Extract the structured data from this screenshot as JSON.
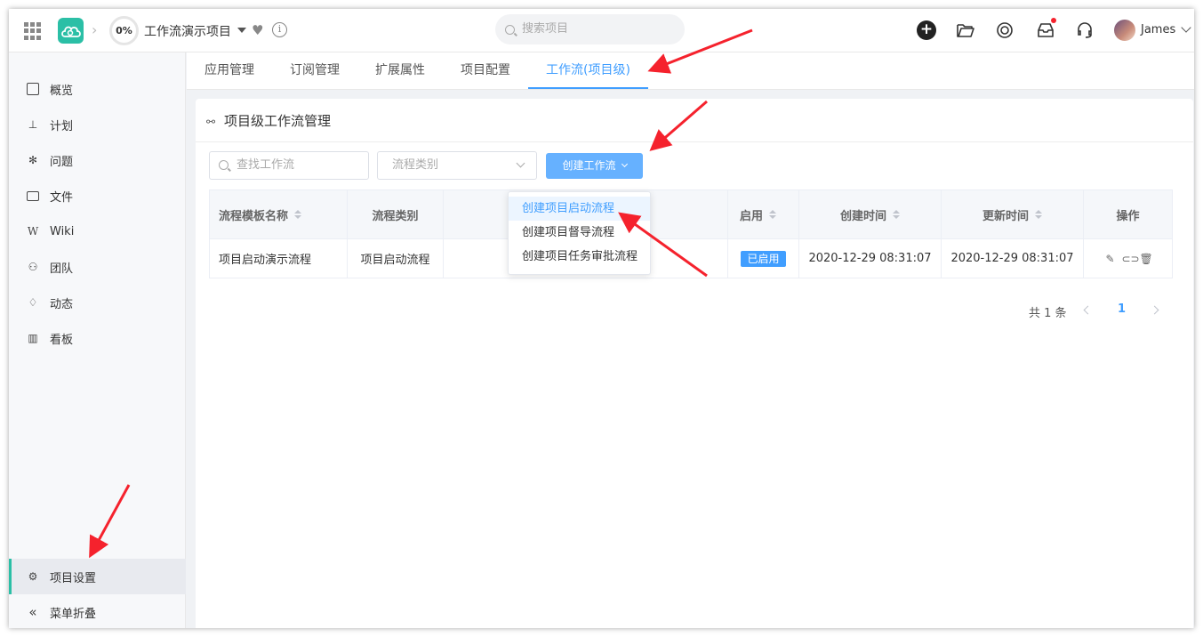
{
  "header": {
    "progress": "0%",
    "project_name": "工作流演示项目",
    "search_placeholder": "搜索项目",
    "user_name": "James"
  },
  "sidebar": {
    "items": [
      {
        "label": "概览"
      },
      {
        "label": "计划"
      },
      {
        "label": "问题"
      },
      {
        "label": "文件"
      },
      {
        "label": "Wiki"
      },
      {
        "label": "团队"
      },
      {
        "label": "动态"
      },
      {
        "label": "看板"
      }
    ],
    "settings_label": "项目设置",
    "collapse_label": "菜单折叠"
  },
  "tabs": [
    {
      "label": "应用管理"
    },
    {
      "label": "订阅管理"
    },
    {
      "label": "扩展属性"
    },
    {
      "label": "项目配置"
    },
    {
      "label": "工作流(项目级)"
    }
  ],
  "card": {
    "title": "项目级工作流管理",
    "find_placeholder": "查找工作流",
    "type_placeholder": "流程类别",
    "create_button": "创建工作流"
  },
  "dropdown": {
    "items": [
      {
        "label": "创建项目启动流程"
      },
      {
        "label": "创建项目督导流程"
      },
      {
        "label": "创建项目任务审批流程"
      }
    ]
  },
  "table": {
    "columns": [
      "流程模板名称",
      "流程类别",
      "",
      "启用",
      "创建时间",
      "更新时间",
      "操作"
    ],
    "rows": [
      {
        "name": "项目启动演示流程",
        "type": "项目启动流程",
        "enabled": "已启用",
        "created": "2020-12-29 08:31:07",
        "updated": "2020-12-29 08:31:07"
      }
    ]
  },
  "pagination": {
    "total": "共 1 条",
    "current": "1"
  },
  "colors": {
    "accent": "#409eff",
    "brand": "#2bbfa6",
    "annotation": "#f5222d"
  }
}
